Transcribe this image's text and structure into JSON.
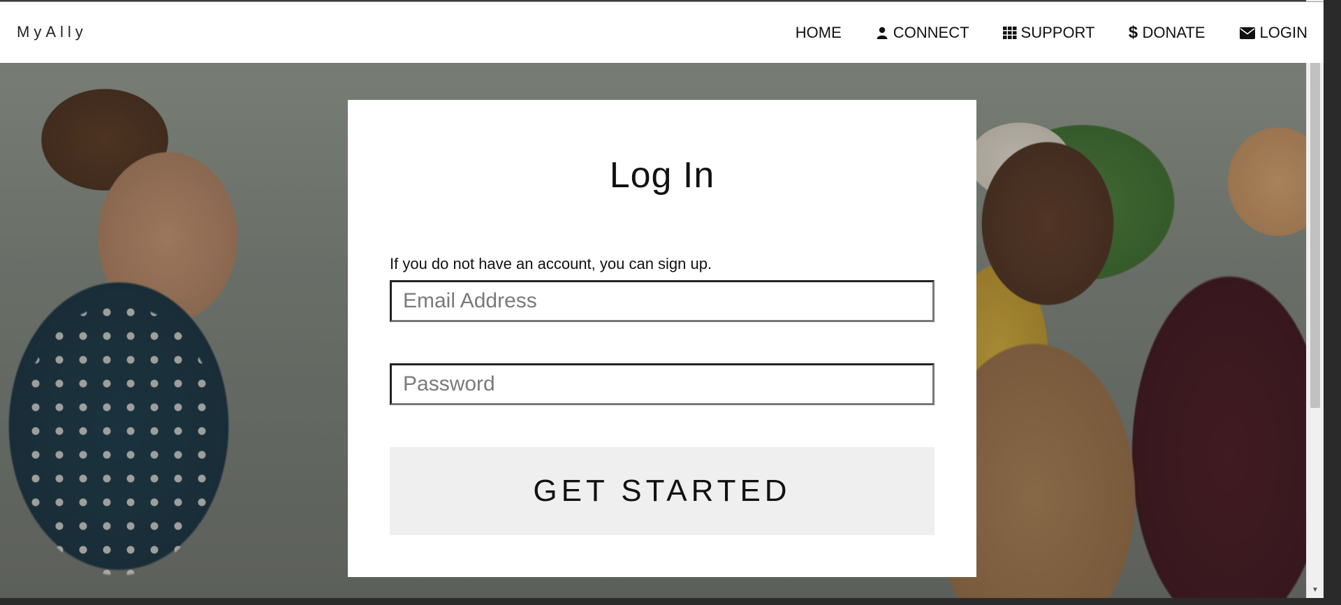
{
  "brand": {
    "name": "MyAlly"
  },
  "nav": {
    "items": [
      {
        "label": "HOME",
        "icon": "none"
      },
      {
        "label": "CONNECT",
        "icon": "user-icon"
      },
      {
        "label": "SUPPORT",
        "icon": "grid-icon"
      },
      {
        "label": "DONATE",
        "icon": "dollar-icon"
      },
      {
        "label": "LOGIN",
        "icon": "envelope-icon"
      }
    ]
  },
  "login": {
    "title": "Log In",
    "signup_text": "If you do not have an account, you can sign up.",
    "email_placeholder": "Email Address",
    "password_placeholder": "Password",
    "submit_label": "GET STARTED"
  },
  "colors": {
    "nav_background": "#ffffff",
    "card_background": "#ffffff",
    "button_background": "#efefef",
    "text": "#111111"
  }
}
